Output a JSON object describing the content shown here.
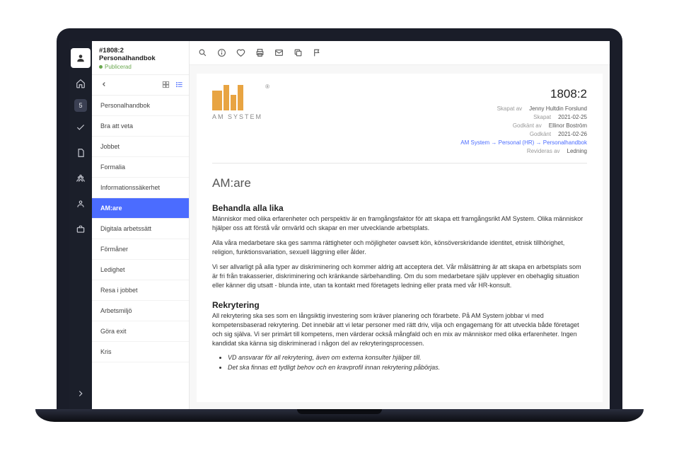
{
  "sidebar": {
    "title": "#1808:2 Personalhandbok",
    "status": "Publicerad",
    "badge": "5",
    "items": [
      {
        "label": "Personalhandbok"
      },
      {
        "label": "Bra att veta"
      },
      {
        "label": "Jobbet"
      },
      {
        "label": "Formalia"
      },
      {
        "label": "Informationssäkerhet"
      },
      {
        "label": "AM:are",
        "active": true
      },
      {
        "label": "Digitala arbetssätt"
      },
      {
        "label": "Förmåner"
      },
      {
        "label": "Ledighet"
      },
      {
        "label": "Resa i jobbet"
      },
      {
        "label": "Arbetsmiljö"
      },
      {
        "label": "Göra exit"
      },
      {
        "label": "Kris"
      }
    ]
  },
  "logo": {
    "brand": "AM SYSTEM"
  },
  "meta": {
    "docid": "1808:2",
    "rows": [
      {
        "label": "Skapat av",
        "value": "Jenny Hultdin Forslund"
      },
      {
        "label": "Skapat",
        "value": "2021-02-25"
      },
      {
        "label": "Godkänt av",
        "value": "Ellinor Boström"
      },
      {
        "label": "Godkänt",
        "value": "2021-02-26"
      },
      {
        "label": "",
        "value": "AM System → Personal (HR) → Personalhandbok",
        "link": true
      },
      {
        "label": "Revideras av",
        "value": "Ledning"
      }
    ]
  },
  "doc": {
    "h1": "AM:are",
    "s1_title": "Behandla alla lika",
    "s1_p1": "Människor med olika erfarenheter och perspektiv är en framgångsfaktor för att skapa ett framgångsrikt AM System. Olika människor hjälper oss att förstå vår omvärld och skapar en mer utvecklande arbetsplats.",
    "s1_p2": "Alla våra medarbetare ska ges samma rättigheter och möjligheter oavsett kön, könsöverskridande identitet, etnisk tillhörighet, religion, funktionsvariation, sexuell läggning eller ålder.",
    "s1_p3": "Vi ser allvarligt på alla typer av diskriminering och kommer aldrig att acceptera det. Vår målsättning är att skapa en arbetsplats som är fri från trakasserier, diskriminering och kränkande särbehandling. Om du som medarbetare själv upplever en obehaglig situation eller känner dig utsatt - blunda inte, utan ta kontakt med företagets ledning eller prata med vår HR-konsult.",
    "s2_title": "Rekrytering",
    "s2_p1": "All rekrytering ska ses som en långsiktig investering som kräver planering och förarbete. På AM System jobbar vi med kompetensbaserad rekrytering. Det innebär att vi letar personer med rätt driv, vilja och engagemang för att utveckla både företaget och sig själva. Vi ser primärt till kompetens, men värderar också mångfald och en mix av människor med olika erfarenheter. Ingen kandidat ska känna sig diskriminerad i någon del av rekryteringsprocessen.",
    "s2_li1": "VD ansvarar för all rekrytering, även om externa konsulter hjälper till.",
    "s2_li2": "Det ska finnas ett tydligt behov och en kravprofil innan rekrytering påbörjas."
  }
}
